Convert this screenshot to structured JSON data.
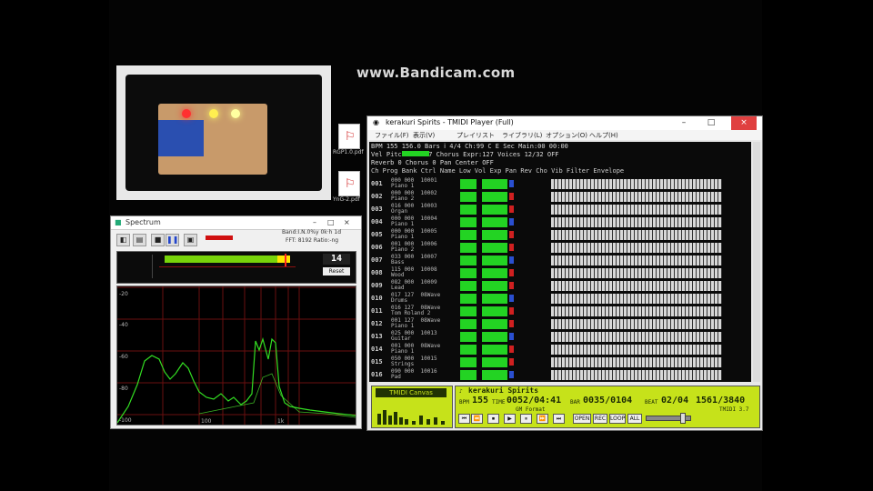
{
  "watermark": "www.Bandicam.com",
  "desktop_files": [
    {
      "name": "RGP1.0.pdf"
    },
    {
      "name": "YnG-2.pdf"
    }
  ],
  "spectrum_window": {
    "title": "Spectrum",
    "info_line1": "Band:I.N.0%y 0k·h 1d",
    "info_line2": "FFT: 8192 Ratio:-ng",
    "level_value": "14",
    "level_label": "Reset",
    "y_ticks": [
      "-20",
      "-40",
      "-60",
      "-80",
      "-100"
    ],
    "x_ticks": [
      "100",
      "1k"
    ],
    "colors": {
      "trace": "#33dd22",
      "grid": "#7a1010"
    }
  },
  "player_window": {
    "title": "kerakuri Spirits - TMIDI Player (Full)",
    "menu": [
      "ファイル(F)",
      "表示(V)",
      "プレイリスト",
      "ライブラリ(L)",
      "オプション(O)",
      "ヘルプ(H)"
    ],
    "status_lines": [
      "BPM  155 156.0 Bars   ⅰ  4/4   Ch:99  C  E  Sec  Main:00  00:00",
      "Vel    Pitchval+107   Chorus   Expr:127   Voices   12/32   OFF",
      "Reverb 0    Chorus 0     Pan Center        OFF",
      "Ch  Prog  Bank  Ctrl Name   Low  Vol Exp Pan Rev Cho   Vib Filter Envelope"
    ],
    "channels": [
      {
        "num": "001",
        "a": "000 000  10001",
        "b": "Piano 1"
      },
      {
        "num": "002",
        "a": "000 000  10002",
        "b": "Piano 2"
      },
      {
        "num": "003",
        "a": "016 000  10003",
        "b": "Organ"
      },
      {
        "num": "004",
        "a": "000 000  10004",
        "b": "Piano 1"
      },
      {
        "num": "005",
        "a": "000 000  10005",
        "b": "Piano 1"
      },
      {
        "num": "006",
        "a": "001 000  10006",
        "b": "Piano 2"
      },
      {
        "num": "007",
        "a": "033 000  10007",
        "b": "Bass"
      },
      {
        "num": "008",
        "a": "115 000  10008",
        "b": "Wood"
      },
      {
        "num": "009",
        "a": "082 000  10009",
        "b": "Lead"
      },
      {
        "num": "010",
        "a": "017 127  08Wave",
        "b": "Drums"
      },
      {
        "num": "011",
        "a": "016 127  08Wave",
        "b": "Tom Roland 2"
      },
      {
        "num": "012",
        "a": "001 127  08Wave",
        "b": "Piano 1"
      },
      {
        "num": "013",
        "a": "025 000  10013",
        "b": "Guitar"
      },
      {
        "num": "014",
        "a": "001 000  08Wave",
        "b": "Piano 1"
      },
      {
        "num": "015",
        "a": "050 000  10015",
        "b": "Strings"
      },
      {
        "num": "016",
        "a": "090 000  10016",
        "b": "Pad"
      }
    ],
    "canvas_label": "TMIDI Canvas",
    "song_title": "kerakuri Spirits",
    "bpm_label": "BPM",
    "bpm": "155",
    "time_label": "TIME",
    "time": "0052/04:41",
    "bar_label": "BAR",
    "bar": "0035/0104",
    "beat_label": "BEAT",
    "beat": "02/04",
    "tick": "1561/3840",
    "sub_left": "GM Format",
    "sub_right": "TMIDI 3.7",
    "controls": [
      "⏮",
      "⏪",
      "⏹",
      "▶",
      "⏸",
      "⏩",
      "⏭",
      "OPEN",
      "REC",
      "LOOP",
      "ALL"
    ],
    "colors": {
      "lcd": "#c6e21a",
      "level": "#23d323"
    }
  }
}
